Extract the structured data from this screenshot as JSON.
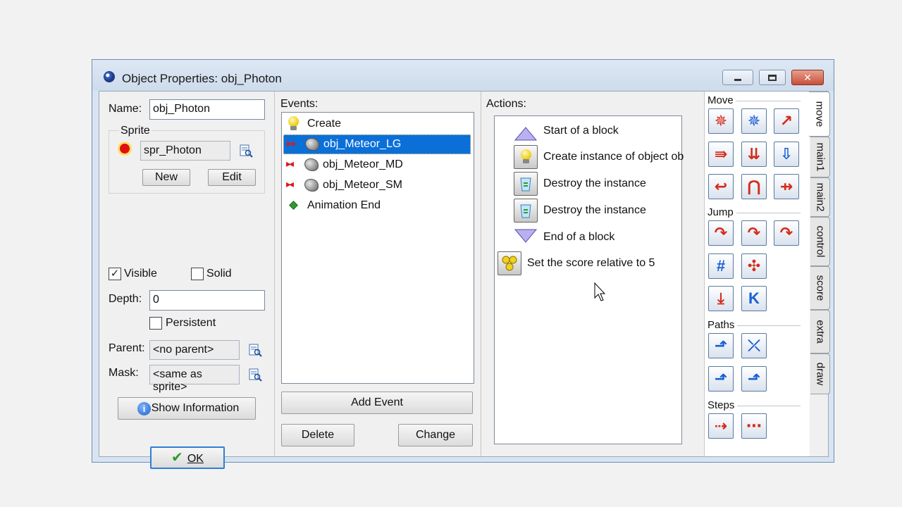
{
  "window": {
    "title": "Object Properties: obj_Photon",
    "close_glyph": "✕"
  },
  "left_panel": {
    "name_label": "Name:",
    "name_value": "obj_Photon",
    "sprite_group": "Sprite",
    "sprite_value": "spr_Photon",
    "new_button": "New",
    "edit_button": "Edit",
    "visible_label": "Visible",
    "visible_checked": true,
    "solid_label": "Solid",
    "solid_checked": false,
    "depth_label": "Depth:",
    "depth_value": "0",
    "persistent_label": "Persistent",
    "persistent_checked": false,
    "parent_label": "Parent:",
    "parent_value": "<no parent>",
    "mask_label": "Mask:",
    "mask_value": "<same as sprite>",
    "show_info_button": "Show Information",
    "ok_button": "OK"
  },
  "events": {
    "header": "Events:",
    "items": [
      {
        "label": "Create",
        "icon": "lightbulb-icon",
        "selected": false
      },
      {
        "label": "obj_Meteor_LG",
        "icon": "collision-icon",
        "selected": true
      },
      {
        "label": "obj_Meteor_MD",
        "icon": "collision-icon",
        "selected": false
      },
      {
        "label": "obj_Meteor_SM",
        "icon": "collision-icon",
        "selected": false
      },
      {
        "label": "Animation End",
        "icon": "green-diamond-icon",
        "selected": false
      }
    ],
    "add_button": "Add Event",
    "delete_button": "Delete",
    "change_button": "Change"
  },
  "actions": {
    "header": "Actions:",
    "items": [
      {
        "label": "Start of a block",
        "icon": "triangle-up-icon"
      },
      {
        "label": "Create instance of object ob",
        "icon": "lightbulb-icon"
      },
      {
        "label": "Destroy the instance",
        "icon": "recycle-bin-icon"
      },
      {
        "label": "Destroy the instance",
        "icon": "recycle-bin-icon"
      },
      {
        "label": "End of a block",
        "icon": "triangle-down-icon"
      },
      {
        "label": "Set the score relative to 5",
        "icon": "score-coins-icon"
      }
    ]
  },
  "library": {
    "sections": {
      "move": "Move",
      "jump": "Jump",
      "paths": "Paths",
      "steps": "Steps"
    },
    "tabs": [
      "move",
      "main1",
      "main2",
      "control",
      "score",
      "extra",
      "draw"
    ],
    "active_tab": "move"
  },
  "colors": {
    "selection": "#0b6fd8",
    "icon_red": "#d62a1a",
    "icon_blue": "#1a5fd6"
  }
}
